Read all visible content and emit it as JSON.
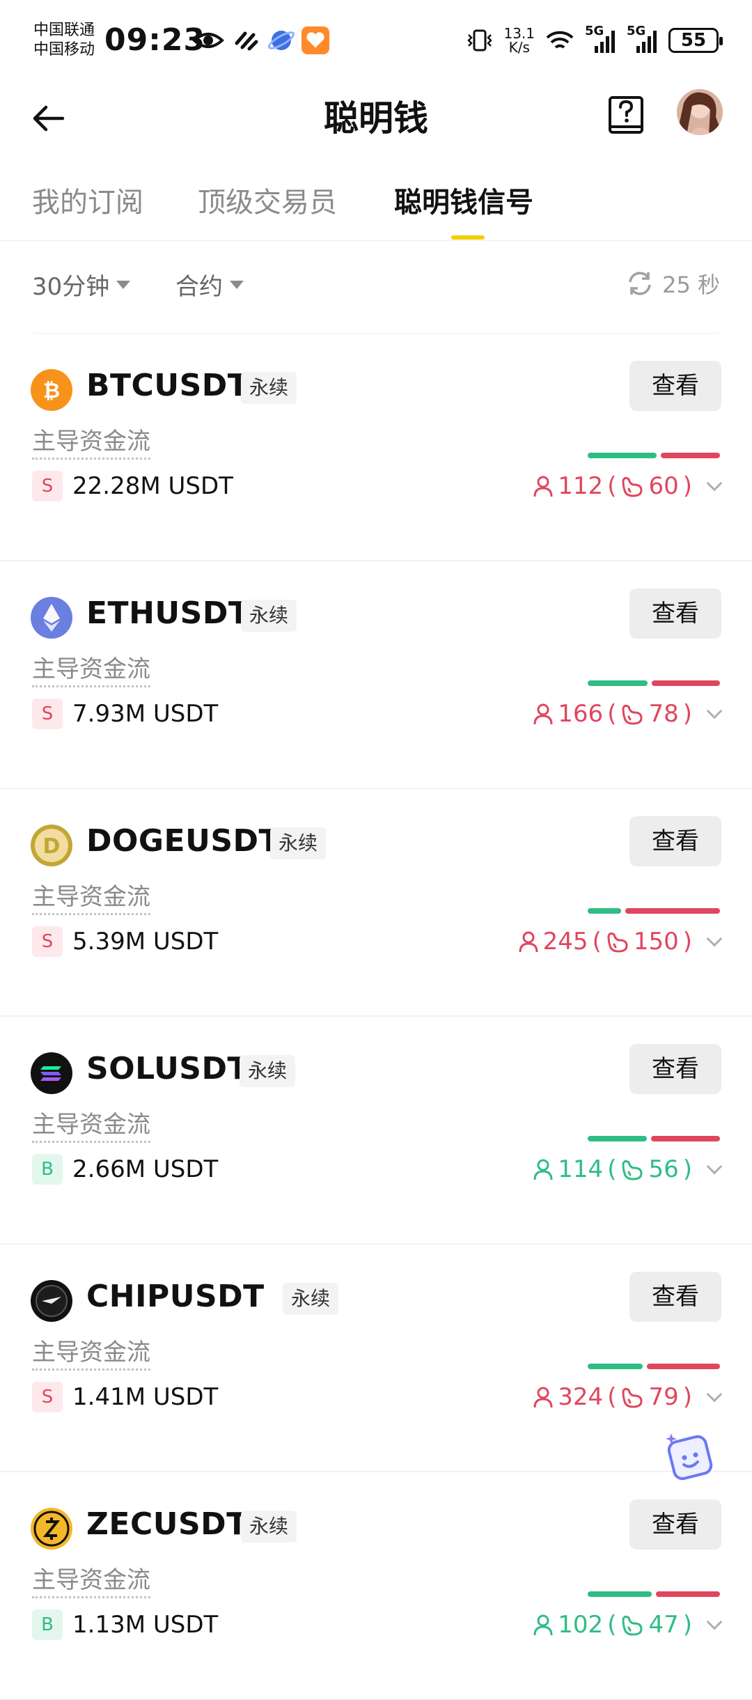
{
  "status_bar": {
    "carrier1": "中国联通",
    "carrier2": "中国移动",
    "time": "09:23",
    "net_speed_value": "13.1",
    "net_speed_unit": "K/s",
    "signal1": "5G",
    "signal2": "5G",
    "battery": "55"
  },
  "header": {
    "title": "聪明钱",
    "back_icon": "arrow-left-icon",
    "help_icon": "help-book-icon"
  },
  "tabs": [
    {
      "label": "我的订阅",
      "active": false
    },
    {
      "label": "顶级交易员",
      "active": false
    },
    {
      "label": "聪明钱信号",
      "active": true
    }
  ],
  "filters": {
    "interval": "30分钟",
    "market": "合约",
    "refresh": "25 秒"
  },
  "flow_label": "主导资金流",
  "view_label": "查看",
  "perp_label": "永续",
  "colors": {
    "green": "#2ebd85",
    "red": "#e0465e",
    "tab_indicator": "#f0d000"
  },
  "cards": [
    {
      "symbol": "BTCUSDT",
      "side": "S",
      "amount": "22.28M USDT",
      "traders": "112",
      "whales": "60",
      "color": "red",
      "long_ratio": 0.54
    },
    {
      "symbol": "ETHUSDT",
      "side": "S",
      "amount": "7.93M USDT",
      "traders": "166",
      "whales": "78",
      "color": "red",
      "long_ratio": 0.47
    },
    {
      "symbol": "DOGEUSDT",
      "side": "S",
      "amount": "5.39M USDT",
      "traders": "245",
      "whales": "150",
      "color": "red",
      "long_ratio": 0.26
    },
    {
      "symbol": "SOLUSDT",
      "side": "B",
      "amount": "2.66M USDT",
      "traders": "114",
      "whales": "56",
      "color": "green",
      "long_ratio": 0.46
    },
    {
      "symbol": "CHIPUSDT",
      "side": "S",
      "amount": "1.41M USDT",
      "traders": "324",
      "whales": "79",
      "color": "red",
      "long_ratio": 0.43
    },
    {
      "symbol": "ZECUSDT",
      "side": "B",
      "amount": "1.13M USDT",
      "traders": "102",
      "whales": "47",
      "color": "green",
      "long_ratio": 0.5
    }
  ]
}
